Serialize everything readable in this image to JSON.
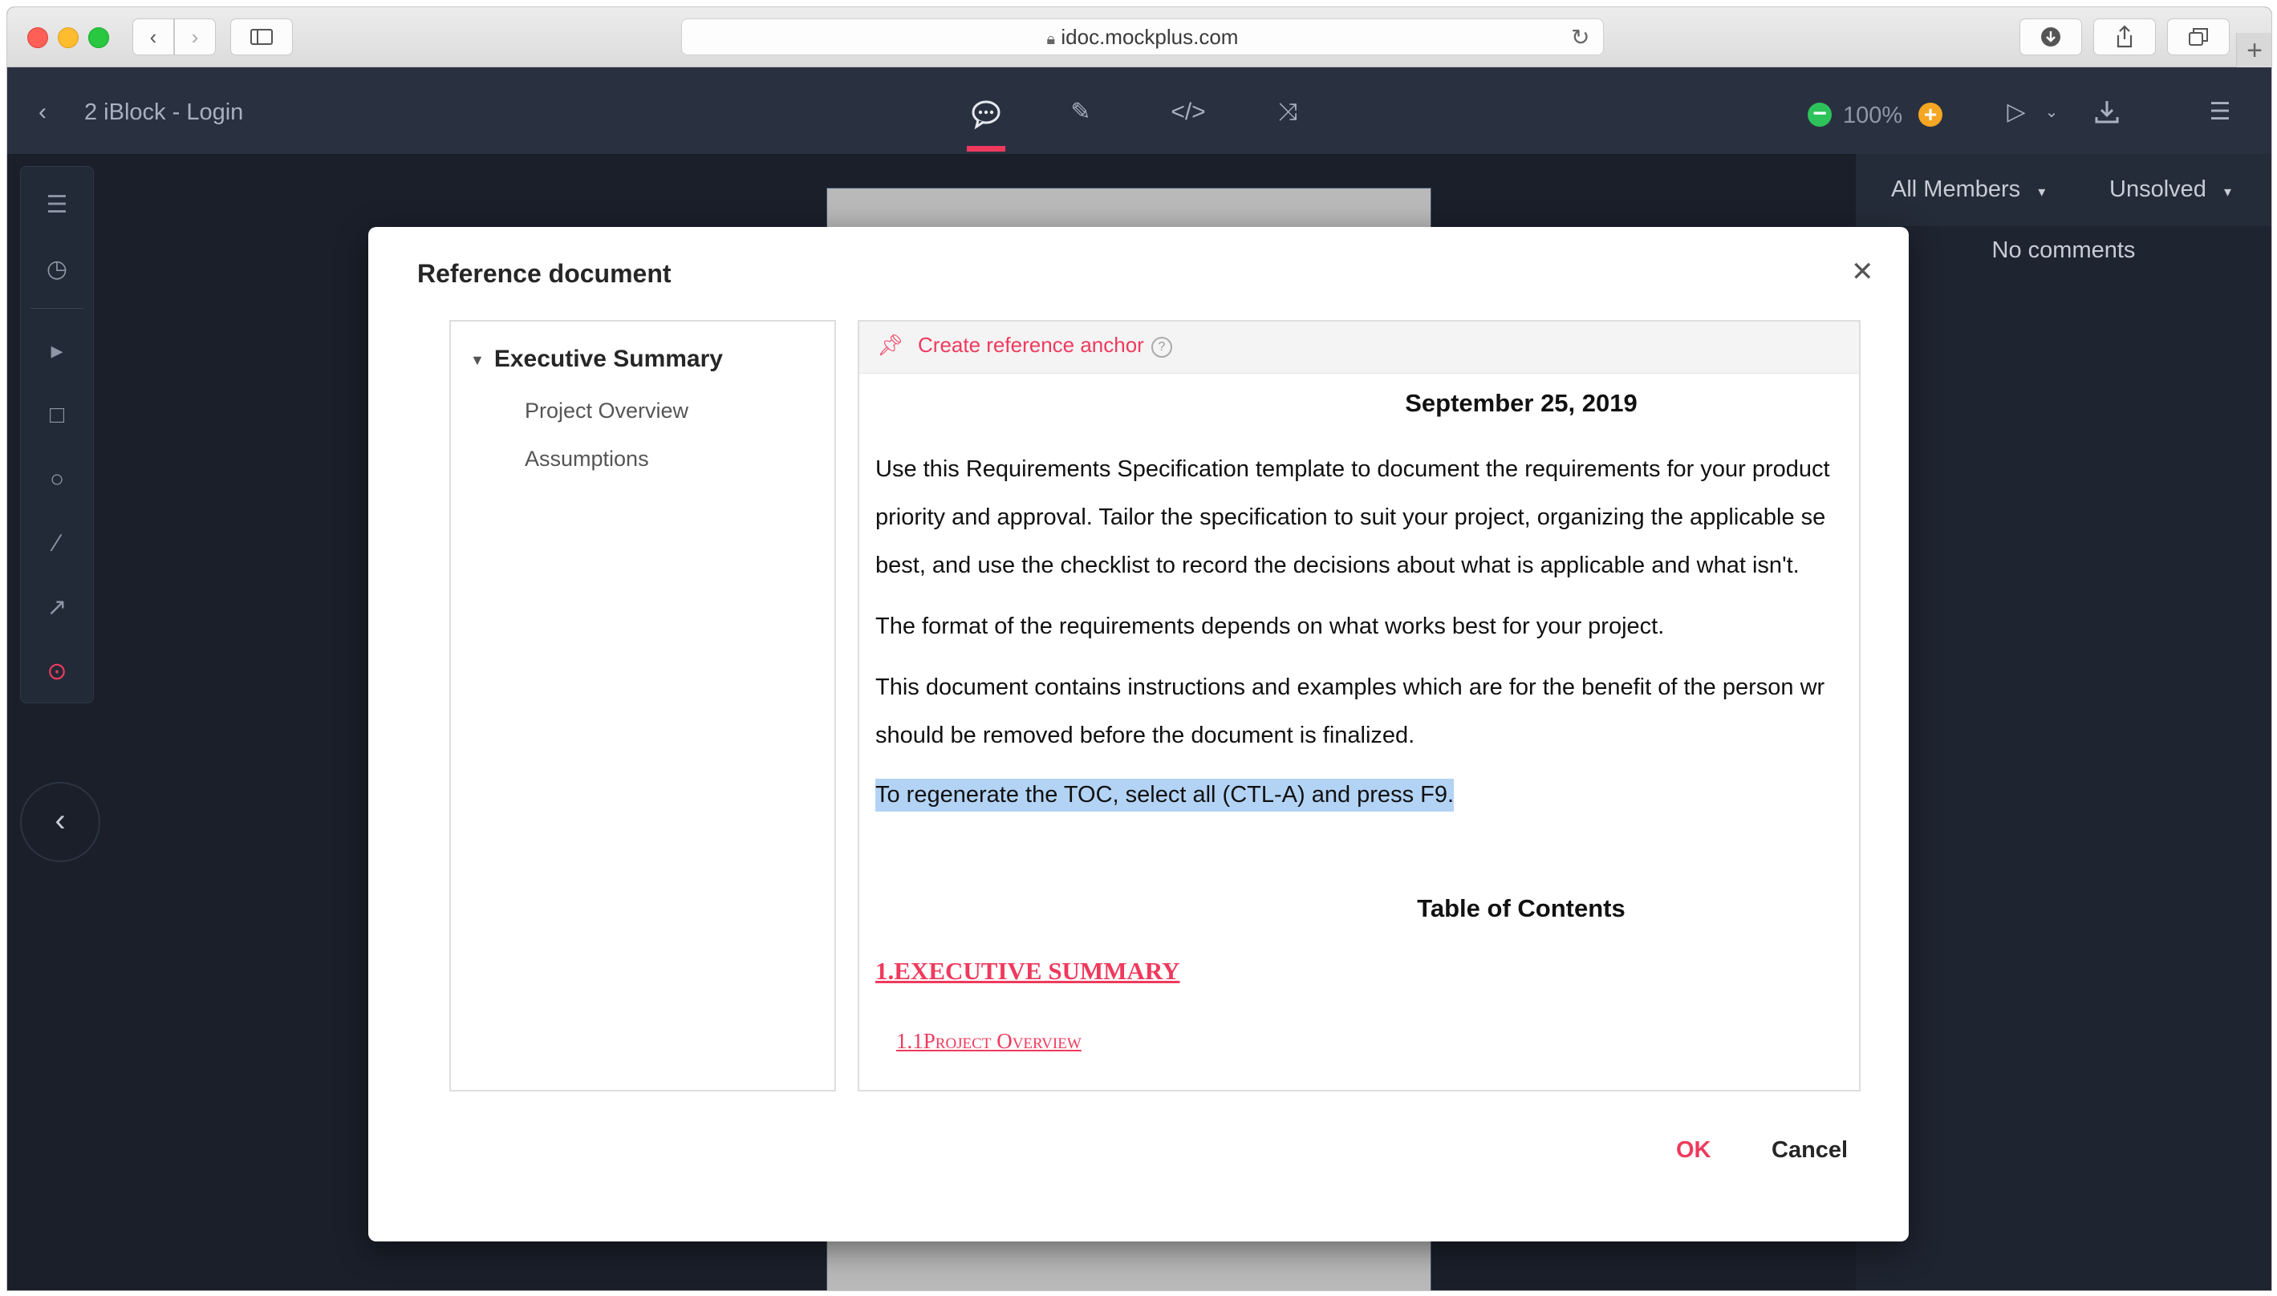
{
  "browser": {
    "url": "idoc.mockplus.com"
  },
  "header": {
    "project_title": "2 iBlock - Login",
    "zoom": "100%"
  },
  "right_panel": {
    "members_filter": "All Members",
    "status_filter": "Unsolved",
    "empty_text": "No comments"
  },
  "modal": {
    "title": "Reference document",
    "anchor_label": "Create reference anchor",
    "ok_label": "OK",
    "cancel_label": "Cancel",
    "tree": {
      "root": "Executive Summary",
      "children": [
        "Project Overview",
        "Assumptions"
      ]
    },
    "document": {
      "date": "September 25, 2019",
      "paragraph1": [
        "Use this Requirements Specification template to document the requirements for your product",
        "priority and approval. Tailor the specification to suit your project, organizing the applicable se",
        "best, and use the checklist to record the decisions about what is applicable and what isn't."
      ],
      "paragraph2": "The format of the requirements depends on what works best for your project.",
      "paragraph3": [
        "This document contains instructions and examples which are for the benefit of the person wr",
        "should be removed before the document is finalized."
      ],
      "highlighted": "To regenerate the TOC, select all (CTL-A) and press F9.",
      "toc_title": "Table of Contents",
      "toc_item1": "1.EXECUTIVE SUMMARY",
      "toc_item2": "1.1Project Overview"
    }
  },
  "colors": {
    "accent": "#ef3a5d",
    "header_bg": "#293141",
    "canvas_bg": "#1a1f2a",
    "selection": "#b3d3f5"
  }
}
